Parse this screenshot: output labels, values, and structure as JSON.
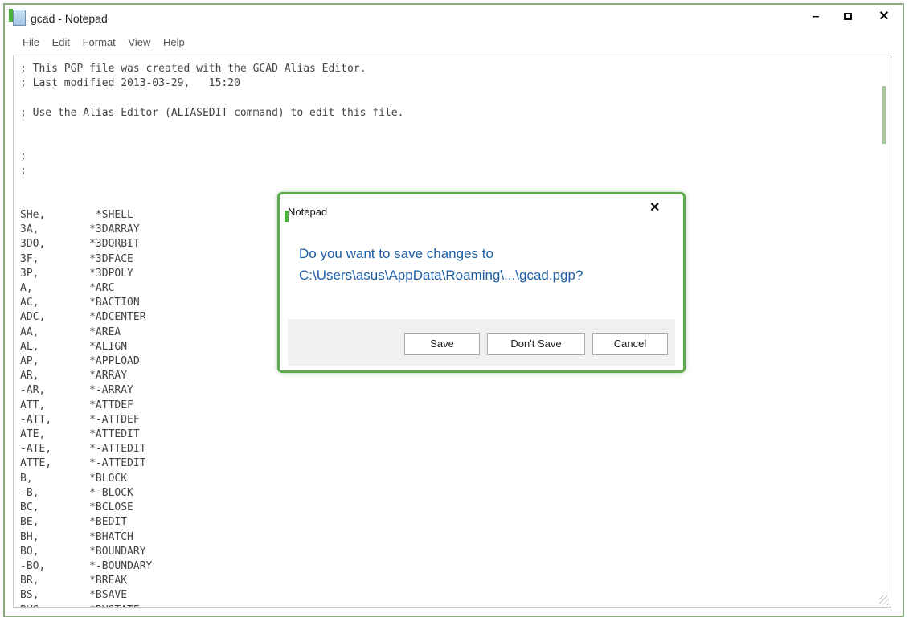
{
  "window": {
    "title": "gcad - Notepad",
    "controls": {
      "minimize": "–",
      "close": "✕"
    }
  },
  "menu": [
    "File",
    "Edit",
    "Format",
    "View",
    "Help"
  ],
  "editor": {
    "lines": [
      "; This PGP file was created with the GCAD Alias Editor.",
      "; Last modified 2013-03-29,   15:20",
      "",
      "; Use the Alias Editor (ALIASEDIT command) to edit this file.",
      "",
      "",
      ";",
      ";",
      "",
      "",
      "SHe,        *SHELL",
      "3A,        *3DARRAY",
      "3DO,       *3DORBIT",
      "3F,        *3DFACE",
      "3P,        *3DPOLY",
      "A,         *ARC",
      "AC,        *BACTION",
      "ADC,       *ADCENTER",
      "AA,        *AREA",
      "AL,        *ALIGN",
      "AP,        *APPLOAD",
      "AR,        *ARRAY",
      "-AR,       *-ARRAY",
      "ATT,       *ATTDEF",
      "-ATT,      *-ATTDEF",
      "ATE,       *ATTEDIT",
      "-ATE,      *-ATTEDIT",
      "ATTE,      *-ATTEDIT",
      "B,         *BLOCK",
      "-B,        *-BLOCK",
      "BC,        *BCLOSE",
      "BE,        *BEDIT",
      "BH,        *BHATCH",
      "BO,        *BOUNDARY",
      "-BO,       *-BOUNDARY",
      "BR,        *BREAK",
      "BS,        *BSAVE",
      "BVS,       *BVSTATE"
    ]
  },
  "dialog": {
    "title": "Notepad",
    "close": "✕",
    "message_line1": "Do you want to save changes to",
    "message_line2": "C:\\Users\\asus\\AppData\\Roaming\\...\\gcad.pgp?",
    "buttons": {
      "save": "Save",
      "dont_save": "Don't Save",
      "cancel": "Cancel"
    }
  }
}
